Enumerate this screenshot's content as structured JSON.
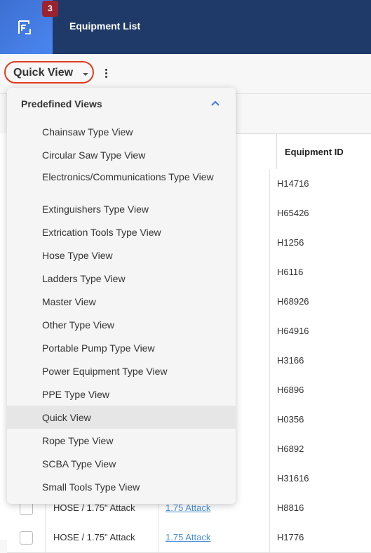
{
  "header": {
    "badge_count": "3",
    "title": "Equipment List"
  },
  "toolbar": {
    "view_label": "Quick View"
  },
  "table": {
    "columns": [
      "Equipment ID"
    ],
    "rows": [
      {
        "id": "H14716"
      },
      {
        "id": "H65426"
      },
      {
        "id": "H1256"
      },
      {
        "id": "H6116"
      },
      {
        "id": "H68926"
      },
      {
        "id": "H64916"
      },
      {
        "id": "H3166"
      },
      {
        "id": "H6896"
      },
      {
        "id": "H0356"
      },
      {
        "id": "H6892"
      },
      {
        "id": "H31616"
      },
      {
        "category": "HOSE / 1.75\" Attack",
        "link": "1.75 Attack",
        "id": "H8816"
      },
      {
        "category": "HOSE / 1.75\" Attack",
        "link": "1.75 Attack",
        "id": "H1776"
      }
    ]
  },
  "dropdown": {
    "header": "Predefined Views",
    "items": [
      "Chainsaw Type View",
      "Circular Saw Type View",
      "Electronics/Communications Type View",
      "Extinguishers Type View",
      "Extrication Tools Type View",
      "Hose Type View",
      "Ladders Type View",
      "Master View",
      "Other Type View",
      "Portable Pump Type View",
      "Power Equipment Type View",
      "PPE Type View",
      "Quick View",
      "Rope Type View",
      "SCBA Type View",
      "Small Tools Type View"
    ],
    "selected": "Quick View"
  },
  "colors": {
    "header_bg": "#1f3a68",
    "app_tile": "#4a86f0",
    "badge": "#9b2330",
    "focus_ring": "#e03a1e",
    "link": "#4a8fd6"
  }
}
